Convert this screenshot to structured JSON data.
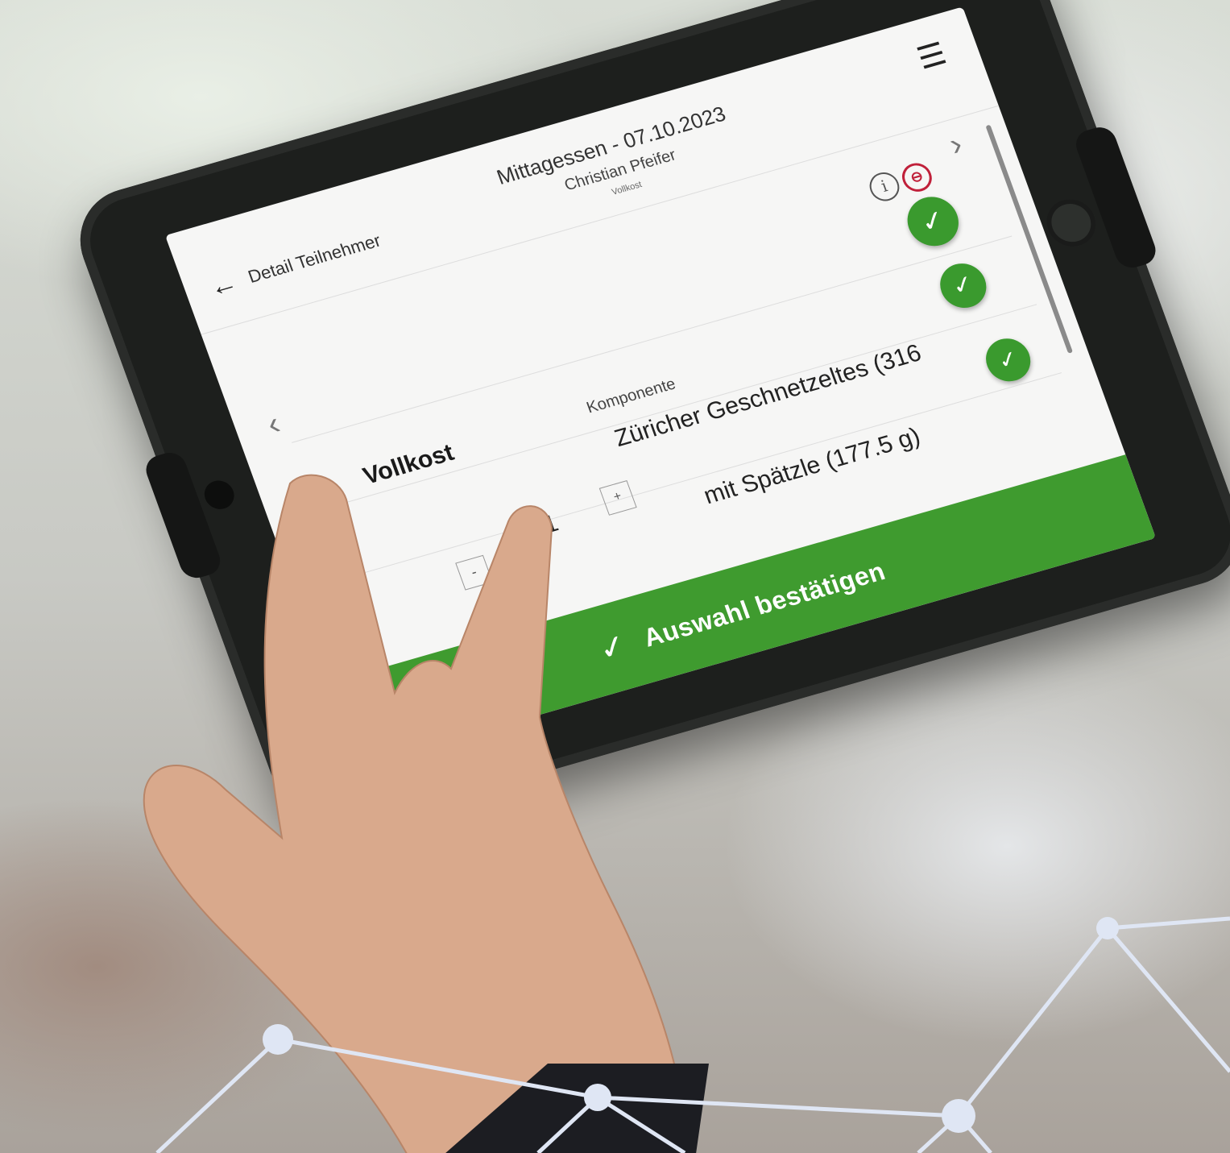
{
  "app": {
    "back_label": "Detail Teilnehmer",
    "meal_title": "Mittagessen - 07.10.2023",
    "person_name": "Christian Pfeifer",
    "diet_small": "Vollkost"
  },
  "icons": {
    "back": "←",
    "menu": "☰",
    "next": "›",
    "prev": "‹",
    "info": "i",
    "check": "✓"
  },
  "content": {
    "diet_heading": "Vollkost",
    "column_heading": "Komponente",
    "items": [
      "Züricher Geschnetzeltes (316",
      "mit Spätzle (177.5 g)"
    ],
    "quantity": "1",
    "plus": "+",
    "minus": "-"
  },
  "footer": {
    "confirm_label": "Auswahl bestätigen"
  },
  "colors": {
    "accent_green": "#3f9b2f",
    "alert_red": "#c0203a",
    "network_lines": "#dfe6f4"
  }
}
